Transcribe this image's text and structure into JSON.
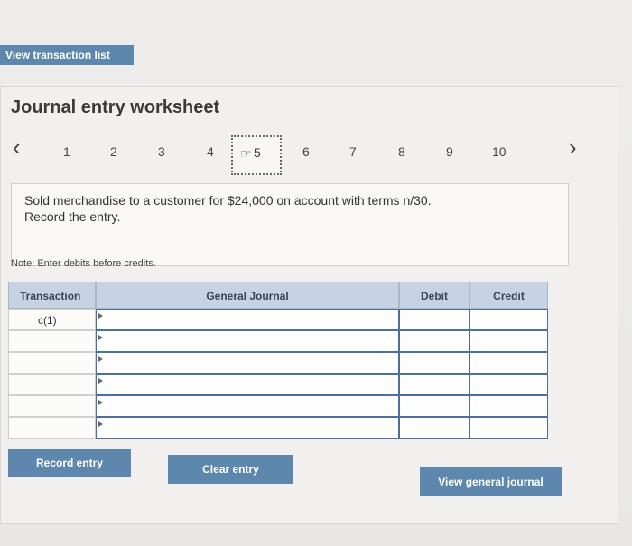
{
  "top_button": {
    "label": "View transaction list"
  },
  "worksheet": {
    "title": "Journal entry worksheet",
    "steps": [
      "1",
      "2",
      "3",
      "4",
      "5",
      "6",
      "7",
      "8",
      "9",
      "10"
    ],
    "active_step": "5",
    "question_line1": "Sold merchandise to a customer for $24,000 on account with terms n/30.",
    "question_line2": "Record the entry.",
    "note": "Note: Enter debits before credits."
  },
  "table": {
    "headers": {
      "transaction": "Transaction",
      "general_journal": "General Journal",
      "debit": "Debit",
      "credit": "Credit"
    },
    "rows": [
      {
        "transaction": "c(1)",
        "account": "",
        "debit": "",
        "credit": ""
      },
      {
        "transaction": "",
        "account": "",
        "debit": "",
        "credit": ""
      },
      {
        "transaction": "",
        "account": "",
        "debit": "",
        "credit": ""
      },
      {
        "transaction": "",
        "account": "",
        "debit": "",
        "credit": ""
      },
      {
        "transaction": "",
        "account": "",
        "debit": "",
        "credit": ""
      },
      {
        "transaction": "",
        "account": "",
        "debit": "",
        "credit": ""
      }
    ]
  },
  "buttons": {
    "record": "Record entry",
    "clear": "Clear entry",
    "view_general": "View general journal"
  },
  "icons": {
    "prev": "chevron-left-icon",
    "next": "chevron-right-icon",
    "cursor": "hand-pointer-icon"
  },
  "colors": {
    "button": "#5d87ac",
    "header": "#c5d3e2"
  }
}
